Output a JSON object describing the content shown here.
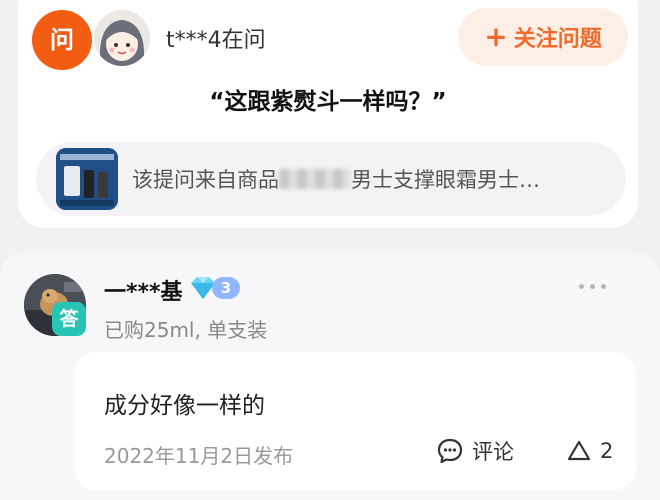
{
  "question": {
    "badge_label": "问",
    "asker_label": "t***4在问",
    "follow_button": {
      "plus": "+",
      "label": "关注问题"
    },
    "title": "“这跟紫熨斗一样吗？”",
    "source": {
      "prefix": "该提问来自商品",
      "suffix": "男士支撑眼霜男士…"
    }
  },
  "answer": {
    "badge_label": "答",
    "user_name": "一***基",
    "level": "3",
    "purchase_info": "已购25ml, 单支装",
    "content": "成分好像一样的",
    "date": "2022年11月2日发布",
    "comment_label": "评论",
    "like_count": "2"
  },
  "colors": {
    "accent_orange": "#f25c13",
    "follow_bg": "#fdeee6",
    "answer_badge": "#27c4b5",
    "level_badge": "#8fb6ff"
  },
  "icons": [
    "question-badge-icon",
    "plus-icon",
    "diamond-icon",
    "more-icon",
    "comment-icon",
    "like-triangle-icon"
  ]
}
